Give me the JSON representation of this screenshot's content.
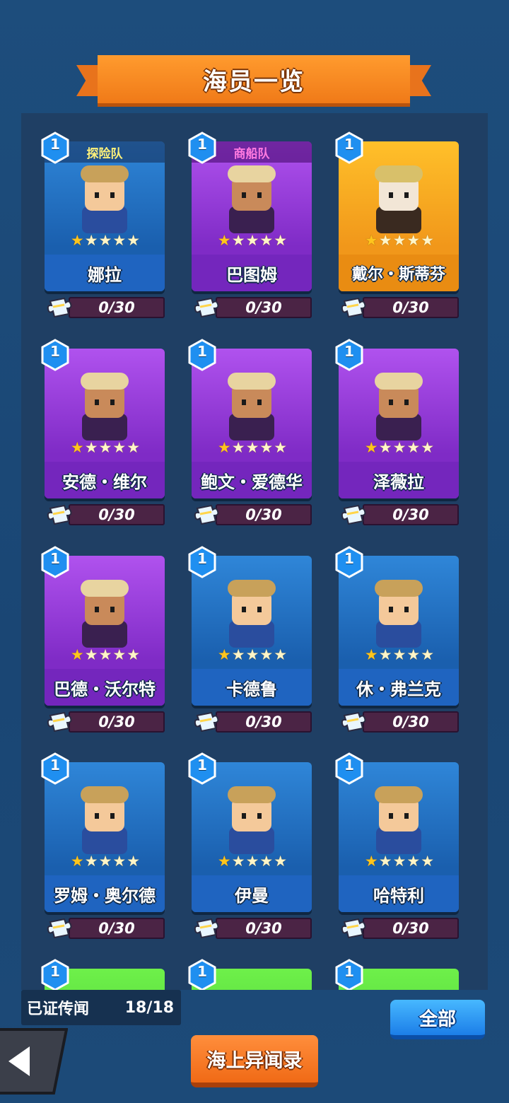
{
  "header": {
    "title": "海员一览"
  },
  "cards": [
    {
      "name": "娜拉",
      "level": "1",
      "team": "探险队",
      "progress": "0/30",
      "rarity": "blue",
      "stars": 1
    },
    {
      "name": "巴图姆",
      "level": "1",
      "team": "商船队",
      "progress": "0/30",
      "rarity": "purple",
      "stars": 1
    },
    {
      "name": "戴尔・斯蒂芬",
      "level": "1",
      "team": "",
      "progress": "0/30",
      "rarity": "gold",
      "stars": 1
    },
    {
      "name": "安德・维尔",
      "level": "1",
      "team": "",
      "progress": "0/30",
      "rarity": "purple",
      "stars": 1
    },
    {
      "name": "鲍文・爱德华",
      "level": "1",
      "team": "",
      "progress": "0/30",
      "rarity": "purple",
      "stars": 1
    },
    {
      "name": "泽薇拉",
      "level": "1",
      "team": "",
      "progress": "0/30",
      "rarity": "purple",
      "stars": 1
    },
    {
      "name": "巴德・沃尔特",
      "level": "1",
      "team": "",
      "progress": "0/30",
      "rarity": "purple",
      "stars": 1
    },
    {
      "name": "卡德鲁",
      "level": "1",
      "team": "",
      "progress": "0/30",
      "rarity": "blue",
      "stars": 1
    },
    {
      "name": "休・弗兰克",
      "level": "1",
      "team": "",
      "progress": "0/30",
      "rarity": "blue",
      "stars": 1
    },
    {
      "name": "罗姆・奥尔德",
      "level": "1",
      "team": "",
      "progress": "0/30",
      "rarity": "blue",
      "stars": 1
    },
    {
      "name": "伊曼",
      "level": "1",
      "team": "",
      "progress": "0/30",
      "rarity": "blue",
      "stars": 1
    },
    {
      "name": "哈特利",
      "level": "1",
      "team": "",
      "progress": "0/30",
      "rarity": "blue",
      "stars": 1
    },
    {
      "name": "",
      "level": "1",
      "team": "",
      "progress": "",
      "rarity": "green",
      "stars": 0
    },
    {
      "name": "",
      "level": "1",
      "team": "",
      "progress": "",
      "rarity": "green",
      "stars": 0
    },
    {
      "name": "",
      "level": "1",
      "team": "",
      "progress": "",
      "rarity": "green",
      "stars": 0
    }
  ],
  "footer": {
    "legend_label": "已证传闻",
    "legend_count": "18/18",
    "all_label": "全部",
    "tales_label": "海上异闻录"
  },
  "icons": {
    "back": "back-arrow-icon",
    "level": "level-hexagon-icon",
    "puzzle": "puzzle-piece-icon",
    "star": "star-icon"
  },
  "colors": {
    "blue": "#1f64c0",
    "purple": "#7426bd",
    "gold": "#e98c12",
    "green": "#4fd63a",
    "accent_orange": "#f07a18"
  }
}
